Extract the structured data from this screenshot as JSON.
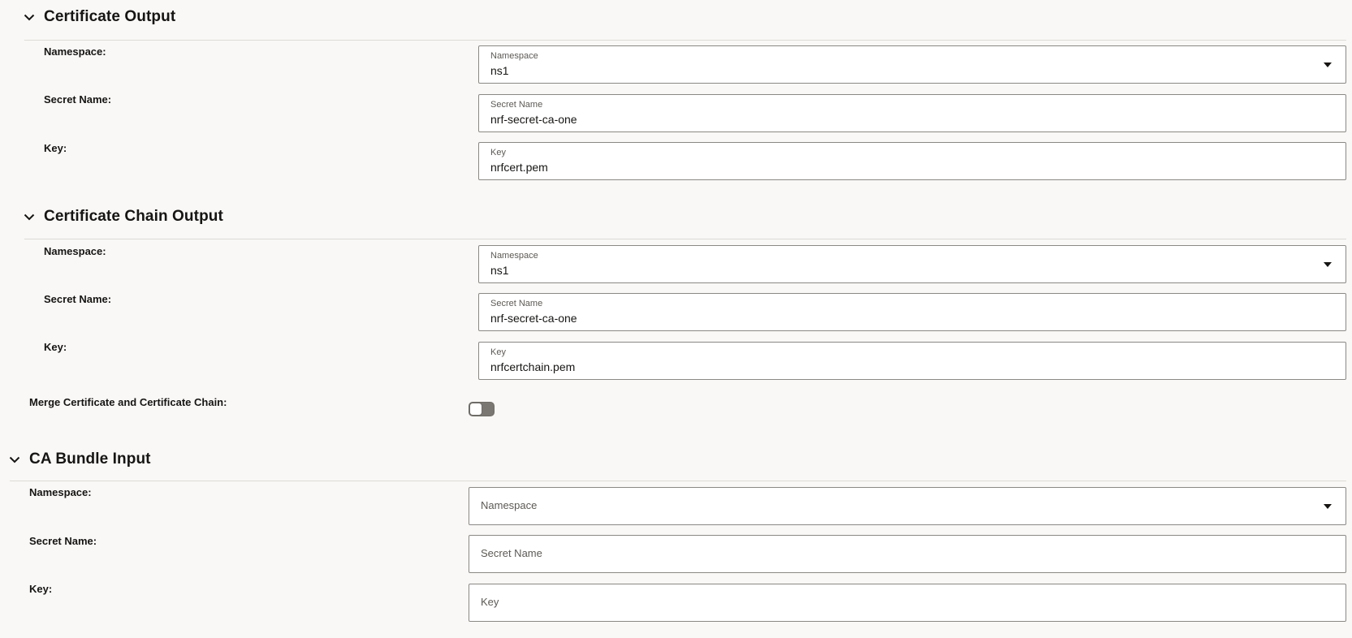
{
  "sections": [
    {
      "title": "Certificate Output",
      "rows": [
        {
          "label": "Namespace:",
          "field_label": "Namespace",
          "value": "ns1"
        },
        {
          "label": "Secret Name:",
          "field_label": "Secret Name",
          "value": "nrf-secret-ca-one"
        },
        {
          "label": "Key:",
          "field_label": "Key",
          "value": "nrfcert.pem"
        }
      ]
    },
    {
      "title": "Certificate Chain Output",
      "rows": [
        {
          "label": "Namespace:",
          "field_label": "Namespace",
          "value": "ns1"
        },
        {
          "label": "Secret Name:",
          "field_label": "Secret Name",
          "value": "nrf-secret-ca-one"
        },
        {
          "label": "Key:",
          "field_label": "Key",
          "value": "nrfcertchain.pem"
        }
      ],
      "merge_label": "Merge Certificate and Certificate Chain:",
      "merge_enabled": false
    },
    {
      "title": "CA Bundle Input",
      "rows": [
        {
          "label": "Namespace:",
          "placeholder": "Namespace"
        },
        {
          "label": "Secret Name:",
          "placeholder": "Secret Name"
        },
        {
          "label": "Key:",
          "placeholder": "Key"
        }
      ]
    }
  ],
  "icons": {
    "collapse": "chevron-down-icon",
    "dropdown": "caret-down-icon"
  },
  "colors": {
    "background": "#f9f8f6",
    "field_border": "#8b8985",
    "toggle_off": "#7a7773"
  }
}
